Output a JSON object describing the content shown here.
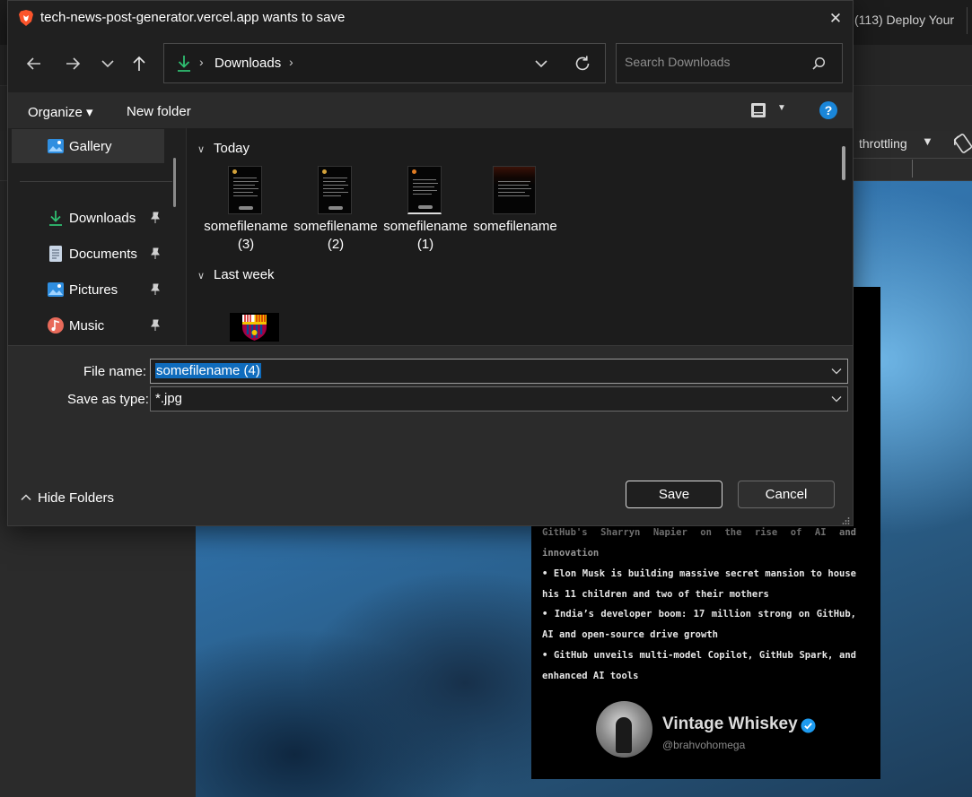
{
  "browser": {
    "tab_title": "(113) Deploy Your",
    "devtools": {
      "throttling_label": "throttling"
    }
  },
  "post_preview": {
    "news_items": [
      "GitHub's Sharryn Napier on the rise of AI and innovation",
      "• Elon Musk is building massive secret mansion to house his 11 children and two of their mothers",
      "• India’s developer boom: 17 million strong on GitHub, AI and open-source drive growth",
      "• GitHub unveils multi-model Copilot, GitHub Spark, and enhanced AI tools"
    ],
    "author_name": "Vintage Whiskey",
    "author_handle": "@brahvohomega"
  },
  "dialog": {
    "title": "tech-news-post-generator.vercel.app wants to save",
    "close_glyph": "✕",
    "address": {
      "location": "Downloads",
      "separator": "›"
    },
    "search": {
      "placeholder": "Search Downloads"
    },
    "toolbar": {
      "organize": "Organize ▾",
      "new_folder": "New folder",
      "help": "?"
    },
    "nav_pane": [
      {
        "label": "Gallery",
        "icon": "gallery-icon",
        "selected": true
      },
      {
        "label": "Downloads",
        "icon": "downloads-icon",
        "pinned": true
      },
      {
        "label": "Documents",
        "icon": "documents-icon",
        "pinned": true
      },
      {
        "label": "Pictures",
        "icon": "pictures-icon",
        "pinned": true
      },
      {
        "label": "Music",
        "icon": "music-icon",
        "pinned": true
      }
    ],
    "groups": [
      {
        "label": "Today",
        "files": [
          {
            "name": "somefilename (3)"
          },
          {
            "name": "somefilename (2)"
          },
          {
            "name": "somefilename (1)"
          },
          {
            "name": "somefilename"
          }
        ]
      },
      {
        "label": "Last week",
        "files": []
      }
    ],
    "file_name": {
      "label": "File name:",
      "value": "somefilename (4)"
    },
    "save_as_type": {
      "label": "Save as type:",
      "value": "*.jpg"
    },
    "hide_folders": "Hide Folders",
    "buttons": {
      "save": "Save",
      "cancel": "Cancel"
    },
    "colors": {
      "accent": "#0f6cbd",
      "help_blue": "#1a86d9",
      "download_green": "#2fbf71"
    }
  }
}
